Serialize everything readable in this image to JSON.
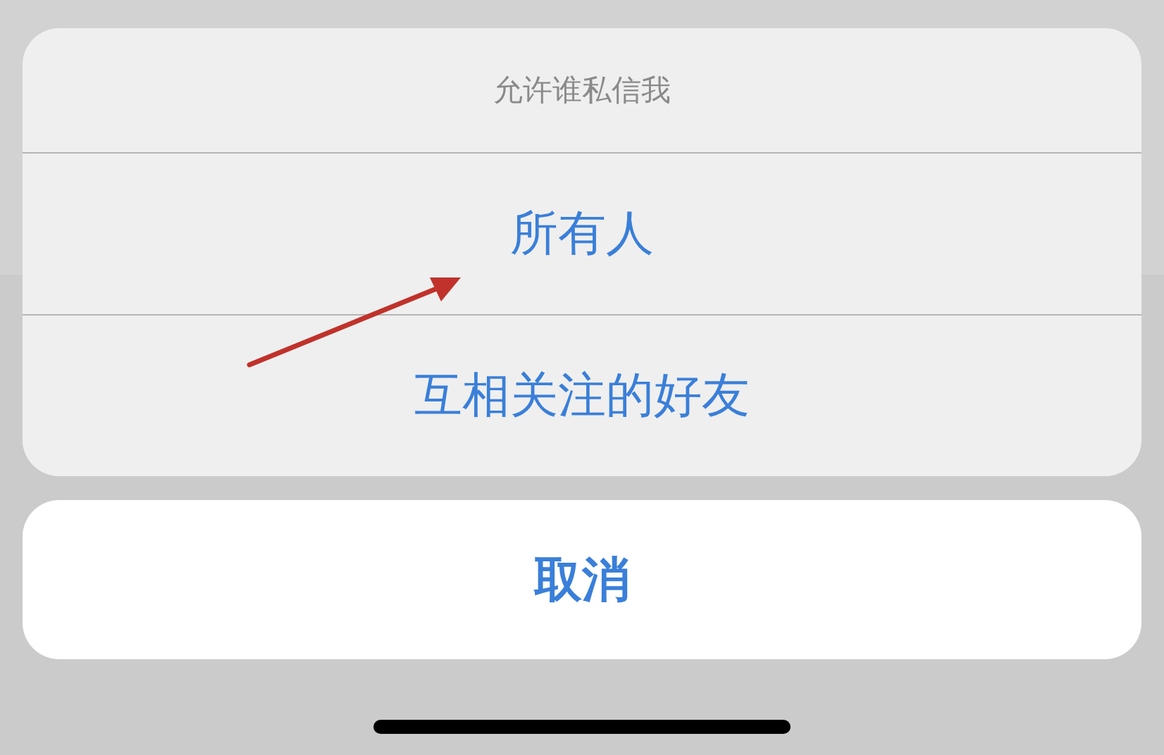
{
  "sheet": {
    "title": "允许谁私信我",
    "options": [
      {
        "label": "所有人"
      },
      {
        "label": "互相关注的好友"
      }
    ],
    "cancel": "取消"
  }
}
